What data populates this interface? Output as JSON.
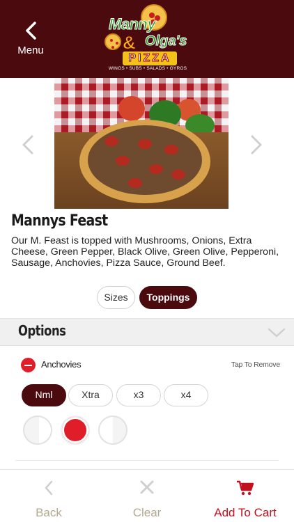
{
  "header": {
    "menu_label": "Menu",
    "logo": {
      "line1": "Manny",
      "amp": "&",
      "line2": "Olga's",
      "pizza": "PIZZA",
      "tagline": "WINGS • SUBS • SALADS • GYROS"
    }
  },
  "product": {
    "title": "Mannys Feast",
    "description": "Our M. Feast is topped with Mushrooms, Onions, Extra Cheese, Green Pepper, Black Olive, Green Olive, Pepperoni, Sausage, Anchovies, Pizza Sauce, Ground Beef."
  },
  "tabs": [
    {
      "label": "Sizes",
      "active": false
    },
    {
      "label": "Toppings",
      "active": true
    }
  ],
  "options": {
    "title": "Options",
    "topping": {
      "name": "Anchovies",
      "action_hint": "Tap To Remove"
    },
    "amounts": [
      {
        "label": "Nml",
        "selected": true
      },
      {
        "label": "Xtra",
        "selected": false
      },
      {
        "label": "x3",
        "selected": false
      },
      {
        "label": "x4",
        "selected": false
      }
    ],
    "portions": [
      "left-half",
      "whole",
      "right-half"
    ],
    "selected_portion": "whole"
  },
  "bottom_nav": {
    "back": "Back",
    "clear": "Clear",
    "add_to_cart": "Add To Cart"
  },
  "colors": {
    "brand": "#4a0a0e",
    "accent_red": "#e01e2a",
    "cart_red": "#c4101c",
    "muted_nav": "#b3aa8e"
  },
  "icons": {
    "back": "chevron-left-icon",
    "carousel_prev": "chevron-left-icon",
    "carousel_next": "chevron-right-icon",
    "collapse": "chevron-down-icon",
    "clear": "close-icon",
    "cart": "cart-icon",
    "remove": "minus-circle-icon"
  }
}
